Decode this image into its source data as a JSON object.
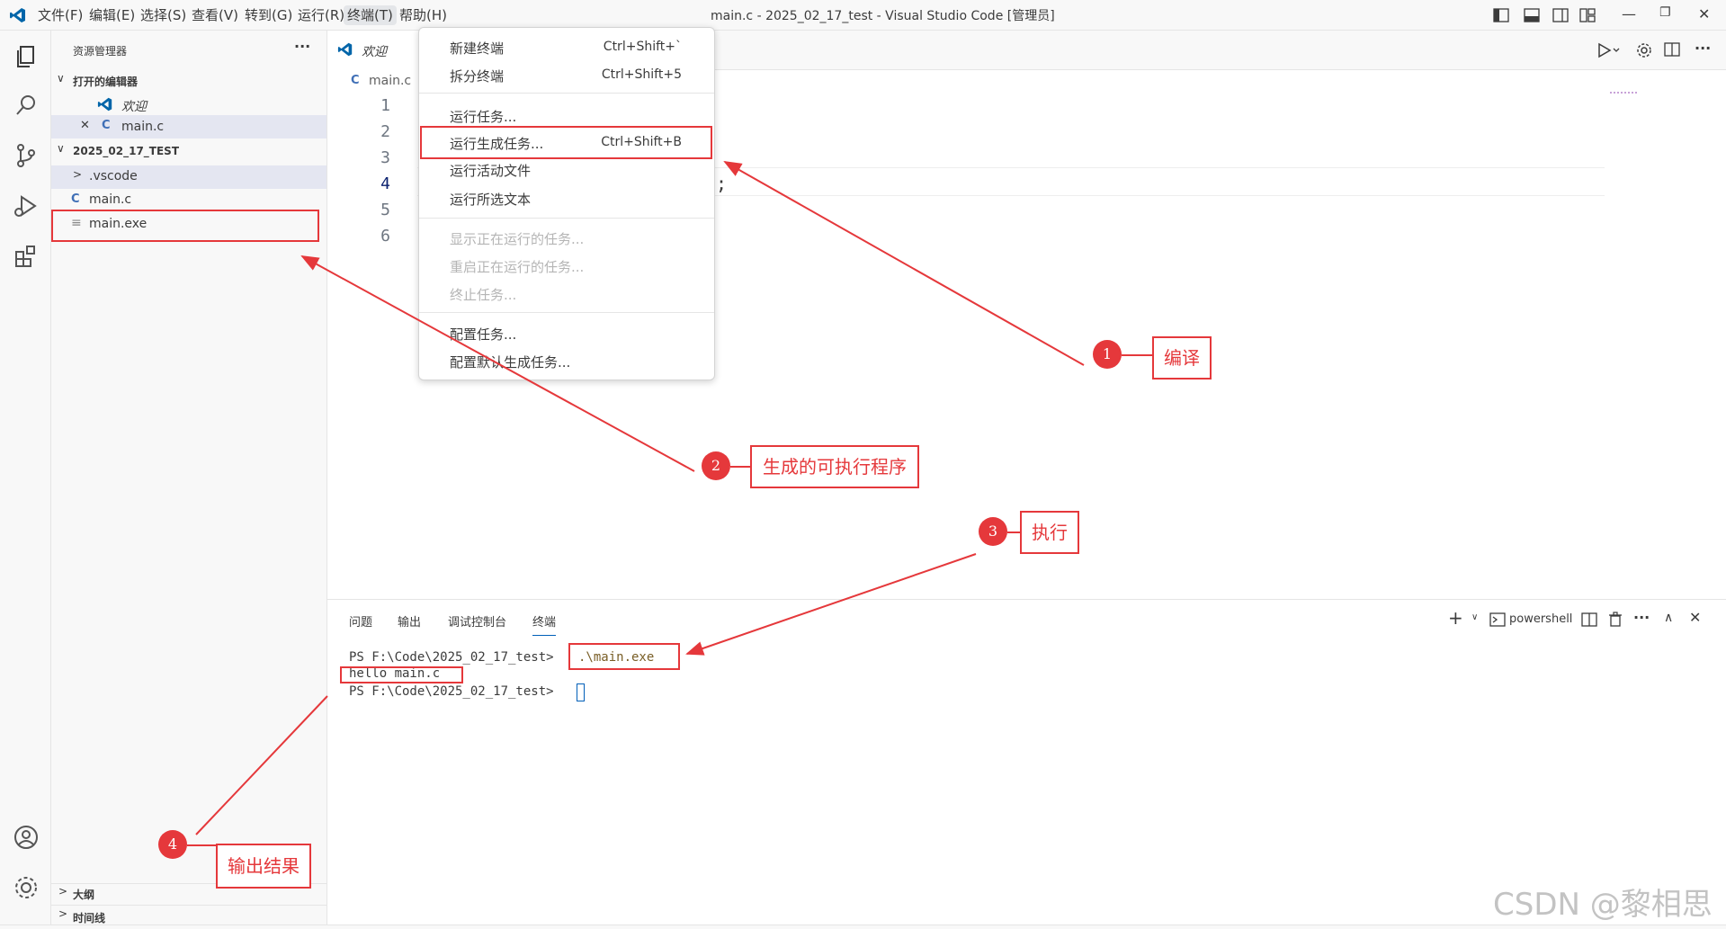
{
  "menubar": {
    "items": [
      "文件(F)",
      "编辑(E)",
      "选择(S)",
      "查看(V)",
      "转到(G)",
      "运行(R)",
      "终端(T)",
      "帮助(H)"
    ],
    "window_title": "main.c - 2025_02_17_test - Visual Studio Code [管理员]"
  },
  "sidebar": {
    "title": "资源管理器",
    "more": "···",
    "open_editors_header": "打开的编辑器",
    "open_editors": [
      {
        "name": "欢迎",
        "icon": "vscode-logo-icon"
      },
      {
        "name": "main.c",
        "icon": "c-file-icon"
      }
    ],
    "folder_header": "2025_02_17_TEST",
    "files": [
      {
        "name": ".vscode",
        "icon": "chevron-right-icon"
      },
      {
        "name": "main.c",
        "icon": "c-file-icon"
      },
      {
        "name": "main.exe",
        "icon": "file-lines-icon"
      }
    ],
    "outline": "大纲",
    "timeline": "时间线"
  },
  "editor": {
    "tab": "欢迎",
    "breadcrumb": "main.c",
    "line_numbers": [
      "1",
      "2",
      "3",
      "4",
      "5",
      "6"
    ],
    "visible_code_char": ";"
  },
  "terminal_menu": {
    "groups": [
      [
        {
          "label": "新建终端",
          "shortcut": "Ctrl+Shift+`",
          "disabled": false
        },
        {
          "label": "拆分终端",
          "shortcut": "Ctrl+Shift+5",
          "disabled": false
        }
      ],
      [
        {
          "label": "运行任务...",
          "shortcut": "",
          "disabled": false
        },
        {
          "label": "运行生成任务...",
          "shortcut": "Ctrl+Shift+B",
          "disabled": false
        },
        {
          "label": "运行活动文件",
          "shortcut": "",
          "disabled": false
        },
        {
          "label": "运行所选文本",
          "shortcut": "",
          "disabled": false
        }
      ],
      [
        {
          "label": "显示正在运行的任务...",
          "shortcut": "",
          "disabled": true
        },
        {
          "label": "重启正在运行的任务...",
          "shortcut": "",
          "disabled": true
        },
        {
          "label": "终止任务...",
          "shortcut": "",
          "disabled": true
        }
      ],
      [
        {
          "label": "配置任务...",
          "shortcut": "",
          "disabled": false
        },
        {
          "label": "配置默认生成任务...",
          "shortcut": "",
          "disabled": false
        }
      ]
    ]
  },
  "panel": {
    "tabs": [
      "问题",
      "输出",
      "调试控制台",
      "终端"
    ],
    "active_tab": "终端",
    "shell": "powershell",
    "terminal_lines": {
      "prompt1": "PS F:\\Code\\2025_02_17_test>",
      "command": ".\\main.exe",
      "output": "hello main.c",
      "prompt2": "PS F:\\Code\\2025_02_17_test>"
    }
  },
  "annotations": [
    {
      "number": "1",
      "label": "编译"
    },
    {
      "number": "2",
      "label": "生成的可执行程序"
    },
    {
      "number": "3",
      "label": "执行"
    },
    {
      "number": "4",
      "label": "输出结果"
    }
  ],
  "watermark": "CSDN @黎相思",
  "colors": {
    "accent": "#005fb8",
    "annotation": "#e5383b",
    "vscode_blue": "#0065a9"
  }
}
